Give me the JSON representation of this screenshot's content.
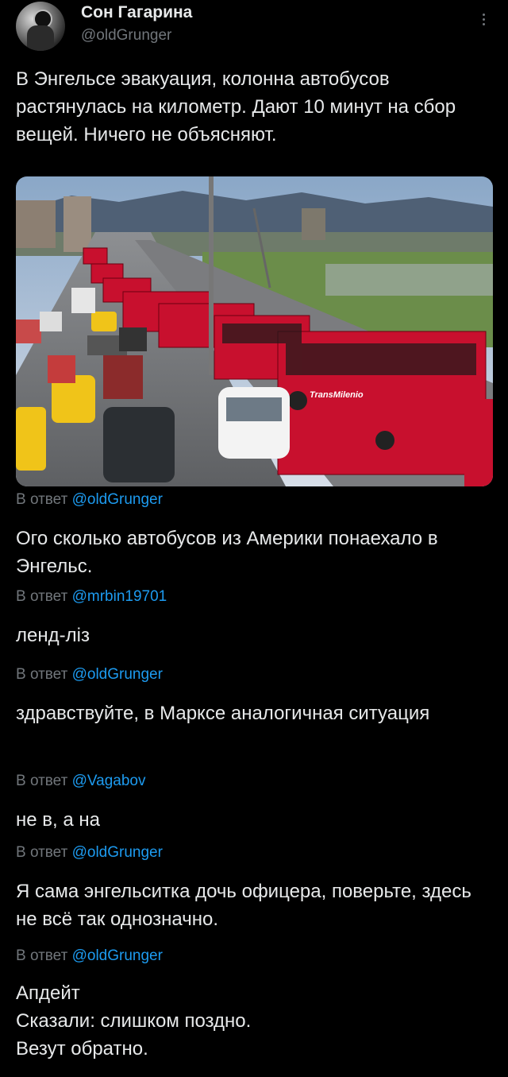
{
  "tweet": {
    "author_name": "Сон Гагарина",
    "author_handle": "@oldGrunger",
    "text": "В Энгельсе эвакуация, колонна автобусов растянулась на километр. Дают 10 минут на сбор вещей. Ничего не объясняют.",
    "media_bus_text": "TransMilenio",
    "avatar_icon": "astronaut-avatar-icon",
    "more_icon": "more-vertical-icon"
  },
  "replies": [
    {
      "prefix": "В ответ",
      "mention": "@oldGrunger",
      "text": "Ого сколько автобусов из Америки понаехало в Энгельс."
    },
    {
      "prefix": "В ответ",
      "mention": "@mrbin19701",
      "text": "ленд-ліз"
    },
    {
      "prefix": "В ответ",
      "mention": "@oldGrunger",
      "text": "здравствуйте, в Марксе аналогичная ситуация"
    },
    {
      "prefix": "В ответ",
      "mention": "@Vagabov",
      "text": "не в, а на"
    },
    {
      "prefix": "В ответ",
      "mention": "@oldGrunger",
      "text": "Я сама энгельситка дочь офицера, поверьте, здесь не всё так однозначно."
    },
    {
      "prefix": "В ответ",
      "mention": "@oldGrunger",
      "lines": [
        "Апдейт",
        "Сказали: слишком поздно.",
        "Везут обратно."
      ]
    }
  ]
}
